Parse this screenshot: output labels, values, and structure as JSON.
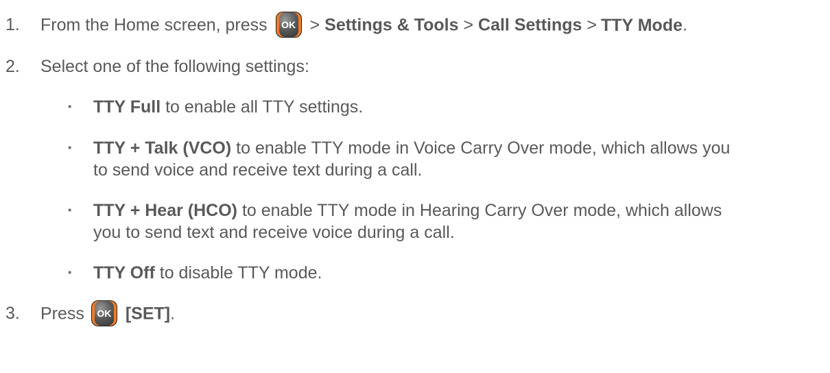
{
  "step1": {
    "num": "1.",
    "pre": "From the Home screen, press",
    "ok_label": "OK",
    "sep": ">",
    "p1": "Settings & Tools",
    "p2": "Call Settings",
    "p3": "TTY Mode",
    "end": "."
  },
  "step2": {
    "num": "2.",
    "text": "Select one of the following settings:"
  },
  "bullets": [
    {
      "marker": "▪",
      "bold": "TTY Full",
      "text": " to enable all TTY settings."
    },
    {
      "marker": "▪",
      "bold": "TTY + Talk (VCO)",
      "text": " to enable TTY mode in Voice Carry Over mode, which allows you",
      "cont": "to send voice and receive text during a call."
    },
    {
      "marker": "▪",
      "bold": "TTY + Hear (HCO)",
      "text": " to enable TTY mode in Hearing Carry Over mode, which allows",
      "cont": "you to send text and receive voice during a call."
    },
    {
      "marker": "▪",
      "bold": "TTY Off",
      "text": " to disable TTY mode."
    }
  ],
  "step3": {
    "num": "3.",
    "pre": "Press",
    "ok_label": "OK",
    "bold": "[SET]",
    "end": "."
  }
}
